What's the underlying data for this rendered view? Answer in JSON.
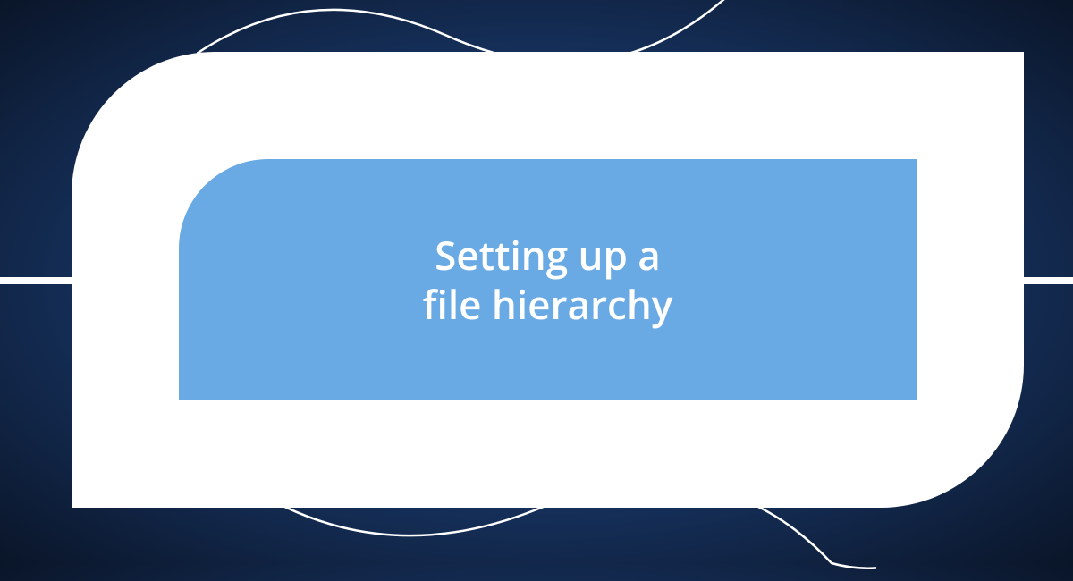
{
  "title_line1": "Setting up a",
  "title_line2": "file hierarchy"
}
